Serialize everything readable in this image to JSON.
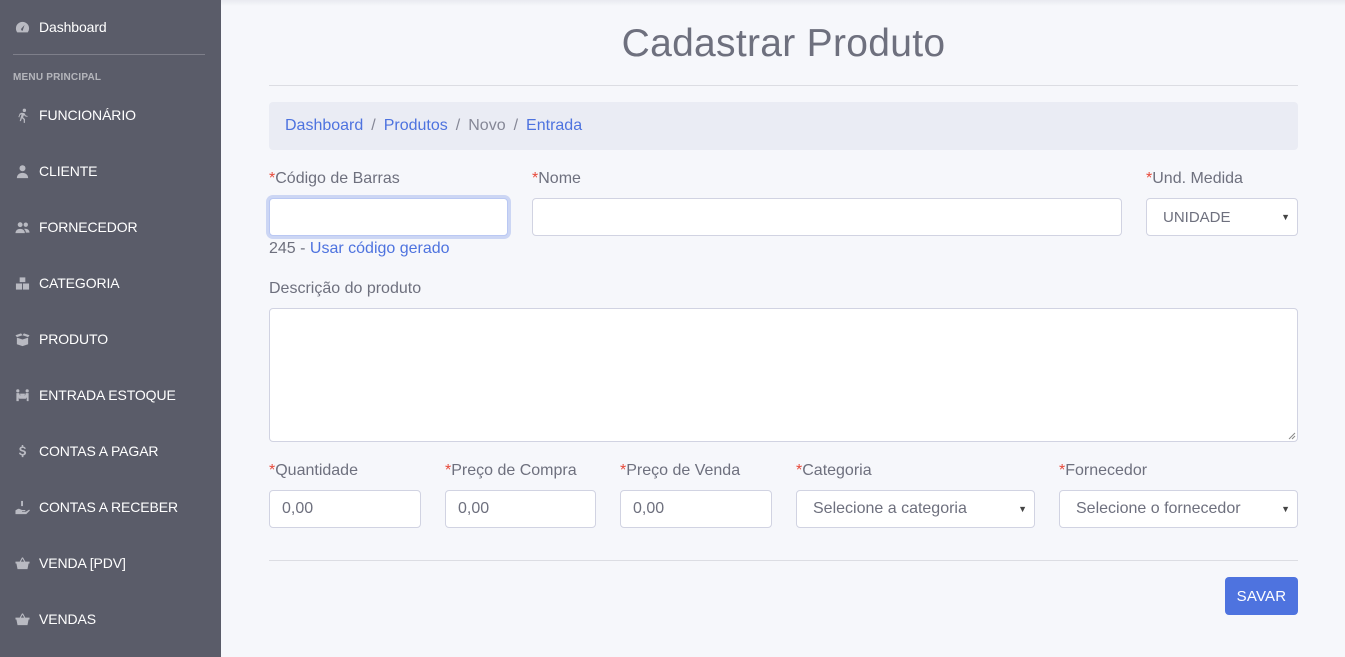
{
  "sidebar": {
    "dashboard": "Dashboard",
    "heading": "MENU PRINCIPAL",
    "items": [
      {
        "label": "FUNCIONÁRIO",
        "icon": "running-person-icon"
      },
      {
        "label": "CLIENTE",
        "icon": "user-icon"
      },
      {
        "label": "FORNECEDOR",
        "icon": "users-icon"
      },
      {
        "label": "CATEGORIA",
        "icon": "cubes-icon"
      },
      {
        "label": "PRODUTO",
        "icon": "box-open-icon"
      },
      {
        "label": "ENTRADA ESTOQUE",
        "icon": "people-carry-icon"
      },
      {
        "label": "CONTAS A PAGAR",
        "icon": "dollar-icon"
      },
      {
        "label": "CONTAS A RECEBER",
        "icon": "hand-holding-icon"
      },
      {
        "label": "VENDA [PDV]",
        "icon": "shopping-basket-icon"
      },
      {
        "label": "VENDAS",
        "icon": "shopping-basket-icon"
      }
    ]
  },
  "page": {
    "title": "Cadastrar Produto"
  },
  "breadcrumb": {
    "items": [
      "Dashboard",
      "Produtos",
      "Novo",
      "Entrada"
    ],
    "separator": "/"
  },
  "form": {
    "required_mark": "*",
    "barcode": {
      "label": "Código de Barras",
      "value": ""
    },
    "generated": {
      "code": "245",
      "dash": " - ",
      "link": "Usar código gerado"
    },
    "name": {
      "label": "Nome",
      "value": ""
    },
    "unit": {
      "label": "Und. Medida",
      "selected": "UNIDADE"
    },
    "description": {
      "label": "Descrição do produto"
    },
    "quantity": {
      "label": "Quantidade",
      "value": "0,00"
    },
    "purchase_price": {
      "label": "Preço de Compra",
      "value": "0,00"
    },
    "sale_price": {
      "label": "Preço de Venda",
      "value": "0,00"
    },
    "category": {
      "label": "Categoria",
      "selected": "Selecione a categoria"
    },
    "supplier": {
      "label": "Fornecedor",
      "selected": "Selecione o fornecedor"
    },
    "save_label": "SAVAR"
  },
  "colors": {
    "sidebar": "#5a5c69",
    "primary": "#4e73df",
    "required": "#e74a3b",
    "background": "#f6f7fb"
  }
}
